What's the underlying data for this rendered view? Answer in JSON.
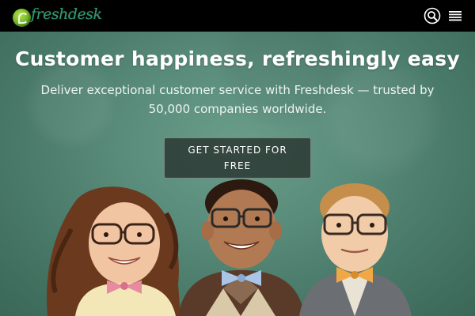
{
  "header": {
    "logo_text": "freshdesk",
    "search_icon": "search-icon",
    "menu_icon": "hamburger-menu-icon"
  },
  "hero": {
    "headline": "Customer happiness, refreshingly easy",
    "subline": "Deliver exceptional customer service with Freshdesk — trusted by 50,000 companies worldwide.",
    "cta_label": "GET STARTED FOR FREE"
  },
  "colors": {
    "topbar": "#000000",
    "chalkboard": "#5a8c7b",
    "cta_bg": "#283430",
    "logo_green": "#6fb52a",
    "wordmark_teal": "#2a9a7a"
  }
}
